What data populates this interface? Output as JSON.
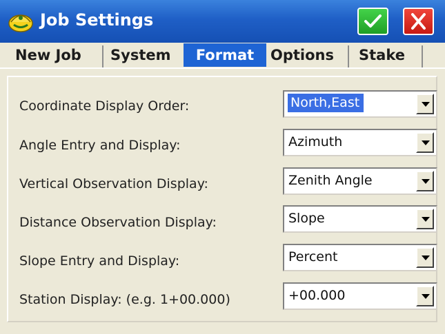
{
  "window": {
    "title": "Job Settings",
    "title_color": "#1f5fc6",
    "ok_icon": "checkmark-icon",
    "close_icon": "close-icon"
  },
  "tabs": [
    {
      "label": "New Job",
      "active": false
    },
    {
      "label": "System",
      "active": false
    },
    {
      "label": "Format",
      "active": true
    },
    {
      "label": "Options",
      "active": false
    },
    {
      "label": "Stake",
      "active": false
    }
  ],
  "settings": [
    {
      "label": "Coordinate Display Order:",
      "value": "North,East",
      "selected": true
    },
    {
      "label": "Angle Entry and Display:",
      "value": "Azimuth",
      "selected": false
    },
    {
      "label": "Vertical Observation Display:",
      "value": "Zenith Angle",
      "selected": false
    },
    {
      "label": "Distance Observation Display:",
      "value": "Slope",
      "selected": false
    },
    {
      "label": "Slope Entry and Display:",
      "value": "Percent",
      "selected": false
    },
    {
      "label": "Station Display: (e.g. 1+00.000)",
      "value": "+00.000",
      "selected": false
    }
  ]
}
